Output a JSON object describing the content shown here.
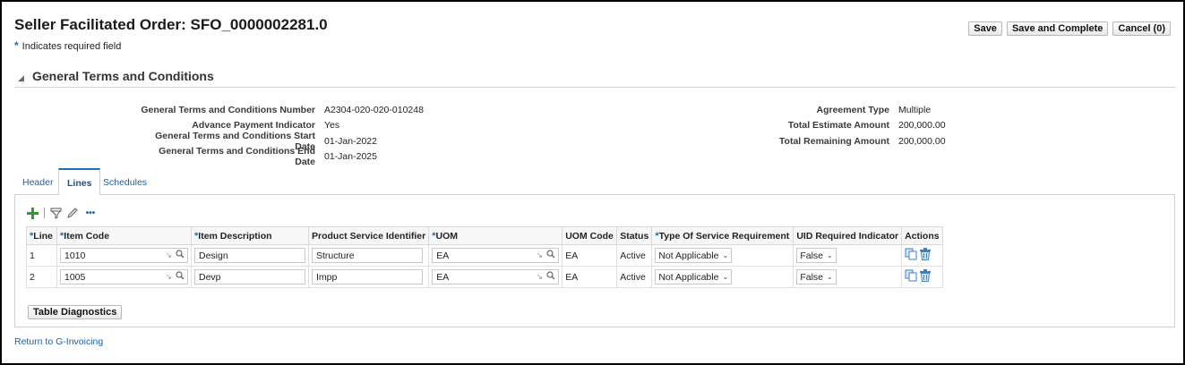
{
  "page": {
    "title": "Seller Facilitated Order: SFO_0000002281.0",
    "required_note": "Indicates required field",
    "required_star": "*"
  },
  "buttons": {
    "save": "Save",
    "save_complete": "Save and Complete",
    "cancel": "Cancel (0)"
  },
  "section": {
    "title": "General Terms and Conditions",
    "collapse_icon": "triangle-down-icon"
  },
  "fields_left": [
    {
      "label": "General Terms and Conditions Number",
      "value": "A2304-020-020-010248"
    },
    {
      "label": "Advance Payment Indicator",
      "value": "Yes"
    },
    {
      "label": "General Terms and Conditions Start Date",
      "value": "01-Jan-2022"
    },
    {
      "label": "General Terms and Conditions End Date",
      "value": "01-Jan-2025"
    }
  ],
  "fields_right": [
    {
      "label": "Agreement Type",
      "value": "Multiple"
    },
    {
      "label": "Total Estimate Amount",
      "value": "200,000.00"
    },
    {
      "label": "Total Remaining Amount",
      "value": "200,000.00"
    }
  ],
  "tabs": [
    {
      "label": "Header",
      "active": false
    },
    {
      "label": "Lines",
      "active": true
    },
    {
      "label": "Schedules",
      "active": false
    }
  ],
  "toolbar": {
    "icons": [
      "add-icon",
      "filter-icon",
      "edit-icon",
      "more-icon"
    ],
    "more_label": "•••"
  },
  "table": {
    "columns": [
      {
        "label": "Line",
        "required": true
      },
      {
        "label": "Item Code",
        "required": true
      },
      {
        "label": "Item Description",
        "required": true
      },
      {
        "label": "Product Service Identifier",
        "required": false
      },
      {
        "label": "UOM",
        "required": true
      },
      {
        "label": "UOM Code",
        "required": false
      },
      {
        "label": "Status",
        "required": false
      },
      {
        "label": "Type Of Service Requirement",
        "required": true
      },
      {
        "label": "UID Required Indicator",
        "required": false
      },
      {
        "label": "Actions",
        "required": false
      }
    ],
    "rows": [
      {
        "line": "1",
        "item_code": "1010",
        "item_description": "Design",
        "psi": "Structure",
        "uom": "EA",
        "uom_code": "EA",
        "status": "Active",
        "service_req": "Not Applicable",
        "uid_required": "False"
      },
      {
        "line": "2",
        "item_code": "1005",
        "item_description": "Devp",
        "psi": "Impp",
        "uom": "EA",
        "uom_code": "EA",
        "status": "Active",
        "service_req": "Not Applicable",
        "uid_required": "False"
      }
    ]
  },
  "diagnostics_button": "Table Diagnostics",
  "return_link": "Return to G-Invoicing",
  "colors": {
    "link": "#1f5f9e",
    "required_star": "#1f6eb5",
    "add_icon": "#2e9a2e"
  }
}
